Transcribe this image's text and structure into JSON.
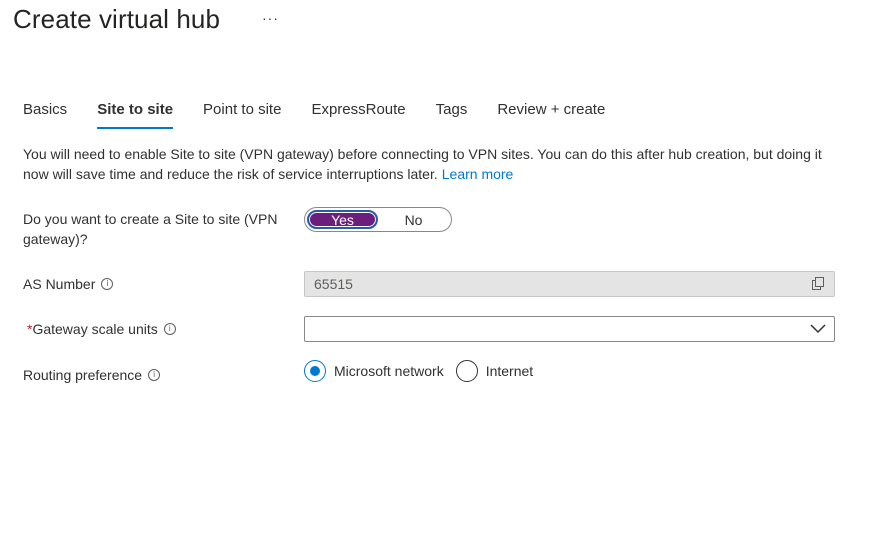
{
  "header": {
    "title": "Create virtual hub",
    "more_label": "···"
  },
  "tabs": [
    {
      "label": "Basics",
      "active": false
    },
    {
      "label": "Site to site",
      "active": true
    },
    {
      "label": "Point to site",
      "active": false
    },
    {
      "label": "ExpressRoute",
      "active": false
    },
    {
      "label": "Tags",
      "active": false
    },
    {
      "label": "Review + create",
      "active": false
    }
  ],
  "info": {
    "text": "You will need to enable Site to site (VPN gateway) before connecting to VPN sites. You can do this after hub creation, but doing it now will save time and reduce the risk of service interruptions later.",
    "link_label": "Learn more"
  },
  "form": {
    "create_s2s": {
      "label": "Do you want to create a Site to site (VPN gateway)?",
      "options": [
        "Yes",
        "No"
      ],
      "selected": "Yes"
    },
    "as_number": {
      "label": "AS Number",
      "value": "65515"
    },
    "gateway_scale_units": {
      "required_mark": "*",
      "label": "Gateway scale units",
      "value": ""
    },
    "routing_preference": {
      "label": "Routing preference",
      "options": [
        "Microsoft network",
        "Internet"
      ],
      "selected": "Microsoft network"
    }
  },
  "icons": {
    "info": "info-icon",
    "copy": "copy-icon",
    "chevron": "chevron-down-icon"
  },
  "colors": {
    "accent": "#0078d4",
    "toggle_selected": "#6b1e7c",
    "required": "#a4262c"
  }
}
